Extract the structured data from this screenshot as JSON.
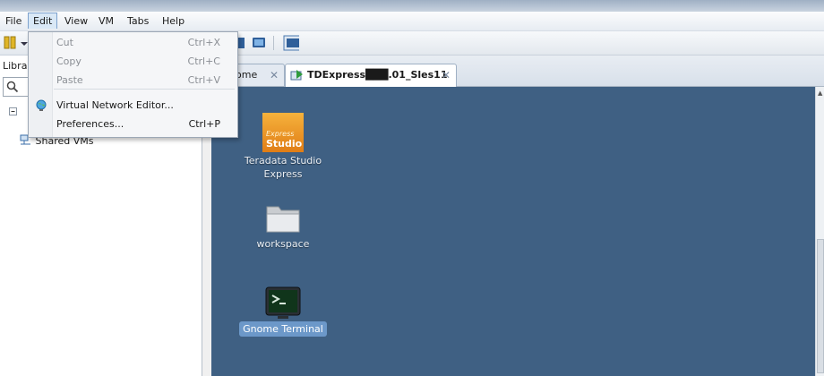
{
  "menu": [
    {
      "label": "File",
      "key": "F"
    },
    {
      "label": "Edit",
      "key": "E"
    },
    {
      "label": "View",
      "key": "V"
    },
    {
      "label": "VM",
      "key": "M"
    },
    {
      "label": "Tabs",
      "key": "T"
    },
    {
      "label": "Help",
      "key": "H"
    }
  ],
  "edit_menu": {
    "items": [
      {
        "label": "Cut",
        "shortcut": "Ctrl+X",
        "enabled": false
      },
      {
        "label": "Copy",
        "shortcut": "Ctrl+C",
        "enabled": false
      },
      {
        "label": "Paste",
        "shortcut": "Ctrl+V",
        "enabled": false
      },
      {
        "label": "Virtual Network Editor...",
        "shortcut": "",
        "enabled": true,
        "icon": "network-globe-icon"
      },
      {
        "label": "Preferences...",
        "shortcut": "Ctrl+P",
        "enabled": true
      }
    ]
  },
  "library": {
    "title": "Librar",
    "tree": [
      {
        "label": "Shared VMs",
        "icon": "shared-vms-icon"
      }
    ]
  },
  "tabs": [
    {
      "label": "ome",
      "selected": false
    },
    {
      "label": "TDExpress███.01_Sles11",
      "selected": true
    }
  ],
  "desktop": {
    "background": "#3f6083",
    "icons": [
      {
        "label_line1": "Teradata Studio",
        "label_line2": "Express",
        "logo_top": "Express",
        "logo_bottom": "Studio"
      },
      {
        "label_line1": "workspace"
      },
      {
        "label_line1": "Gnome Terminal",
        "selected": true
      }
    ]
  }
}
